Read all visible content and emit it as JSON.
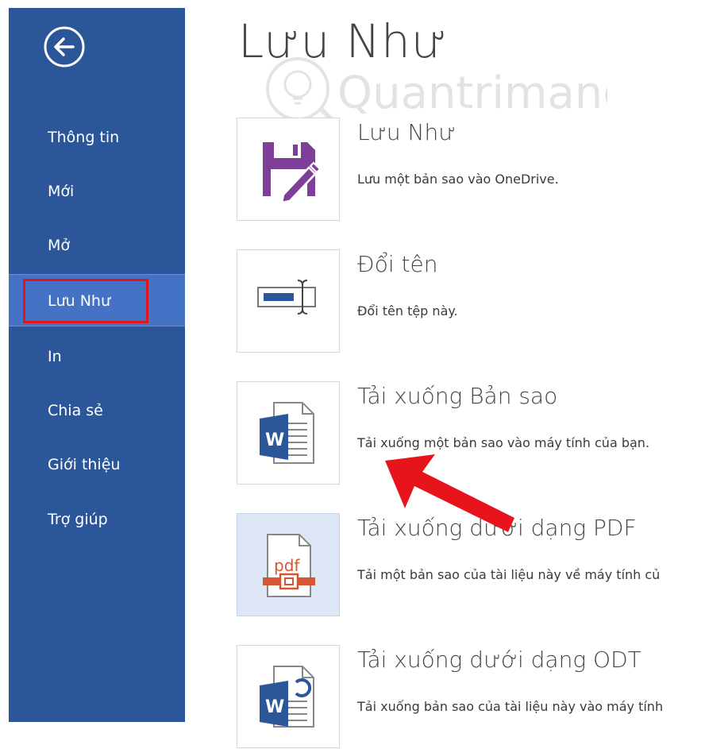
{
  "sidebar": {
    "back_icon": "back-arrow-icon",
    "items": [
      {
        "label": "Thông tin"
      },
      {
        "label": "Mới"
      },
      {
        "label": "Mở"
      },
      {
        "label": "Lưu Như",
        "active": true
      },
      {
        "label": "In"
      },
      {
        "label": "Chia sẻ"
      },
      {
        "label": "Giới thiệu"
      },
      {
        "label": "Trợ giúp"
      }
    ]
  },
  "main": {
    "title": "Lưu Như",
    "options": [
      {
        "title": "Lưu Như",
        "description": "Lưu một bản sao vào OneDrive.",
        "icon": "save-as-floppy-icon"
      },
      {
        "title": "Đổi tên",
        "description": "Đổi tên tệp này.",
        "icon": "rename-icon"
      },
      {
        "title": "Tải xuống Bản sao",
        "description": "Tải xuống một bản sao vào máy tính của bạn.",
        "icon": "word-document-icon"
      },
      {
        "title": "Tải xuống dưới dạng PDF",
        "description": "Tải một bản sao của tài liệu này về máy tính củ",
        "icon": "pdf-document-icon",
        "selected": true
      },
      {
        "title": "Tải xuống dưới dạng ODT",
        "description": "Tải xuống bản sao của tài liệu này vào máy tính",
        "icon": "odt-document-icon"
      }
    ],
    "pdf_icon_label": "pdf",
    "word_icon_letter": "W"
  },
  "watermark": {
    "text": "Quantrimang"
  },
  "colors": {
    "sidebar": "#2b579a",
    "sidebar_active": "#4472c4",
    "highlight": "#e0151a",
    "selected_tile": "#dce6f4",
    "save_icon": "#7e3f98",
    "pdf_accent": "#d65532",
    "word_blue": "#2b579a",
    "arrow": "#e8141c"
  }
}
